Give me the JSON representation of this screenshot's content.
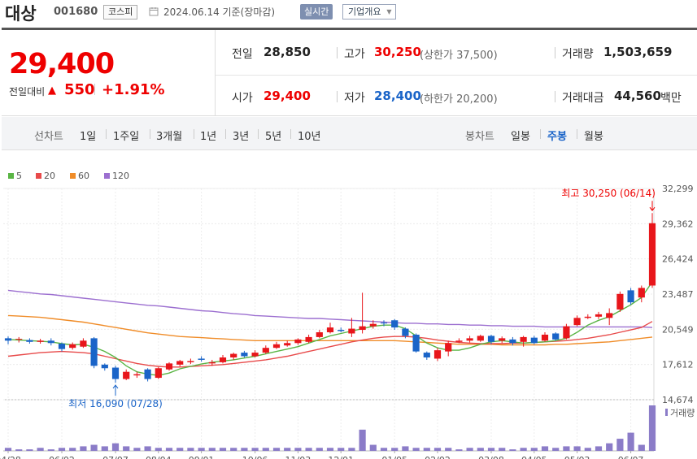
{
  "header": {
    "name": "대상",
    "code": "001680",
    "market": "코스피",
    "date": "2024.06.14 기준(장마감)",
    "realtime_label": "실시간",
    "corp_label": "기업개요"
  },
  "price": {
    "current": "29,400",
    "change_label": "전일대비",
    "change": "550",
    "change_pct": "+1.91%",
    "prev_label": "전일",
    "prev": "28,850",
    "high_label": "고가",
    "high": "30,250",
    "upper_limit": "(상한가 37,500)",
    "volume_label": "거래량",
    "volume": "1,503,659",
    "open_label": "시가",
    "open": "29,400",
    "low_label": "저가",
    "low": "28,400",
    "lower_limit": "(하한가 20,200)",
    "amount_label": "거래대금",
    "amount": "44,560",
    "amount_unit": "백만"
  },
  "period": {
    "line_label": "선차트",
    "line_items": [
      "1일",
      "1주일",
      "3개월",
      "1년",
      "3년",
      "5년",
      "10년"
    ],
    "candle_label": "봉차트",
    "candle_items": [
      "일봉",
      "주봉",
      "월봉"
    ],
    "candle_selected": "주봉"
  },
  "colors": {
    "up": "#e8161b",
    "down": "#1a64c8",
    "ma5": "#5ab545",
    "ma20": "#e84a4a",
    "ma60": "#f08c28",
    "ma120": "#9c6fd0",
    "volume": "#8b7cc8"
  },
  "chart_data": {
    "type": "candlestick",
    "legend": [
      {
        "name": "5",
        "color": "#5ab545"
      },
      {
        "name": "20",
        "color": "#e84a4a"
      },
      {
        "name": "60",
        "color": "#f08c28"
      },
      {
        "name": "120",
        "color": "#9c6fd0"
      }
    ],
    "y_ticks": [
      14674,
      17612,
      20549,
      23487,
      26424,
      29362,
      32299
    ],
    "y_tick_labels": [
      "14,674",
      "17,612",
      "20,549",
      "23,487",
      "26,424",
      "29,362",
      "32,299"
    ],
    "ylim": [
      14674,
      32299
    ],
    "x_tick_labels": [
      "04/28",
      "06/02",
      "07/07",
      "08/04",
      "09/01",
      "10/06",
      "11/03",
      "12/01",
      "01/05",
      "02/02",
      "03/08",
      "04/05",
      "05/03",
      "06/07"
    ],
    "x_tick_index": [
      0,
      5,
      10,
      14,
      18,
      23,
      27,
      31,
      36,
      40,
      45,
      49,
      53,
      58
    ],
    "candles": [
      {
        "o": 19800,
        "c": 19600,
        "h": 19950,
        "l": 19300
      },
      {
        "o": 19700,
        "c": 19750,
        "h": 19900,
        "l": 19450
      },
      {
        "o": 19650,
        "c": 19500,
        "h": 19800,
        "l": 19350
      },
      {
        "o": 19500,
        "c": 19600,
        "h": 19750,
        "l": 19350
      },
      {
        "o": 19600,
        "c": 19400,
        "h": 19800,
        "l": 19200
      },
      {
        "o": 19350,
        "c": 18900,
        "h": 19450,
        "l": 18700
      },
      {
        "o": 19000,
        "c": 19300,
        "h": 19450,
        "l": 18850
      },
      {
        "o": 19100,
        "c": 19600,
        "h": 19800,
        "l": 19000
      },
      {
        "o": 19800,
        "c": 17500,
        "h": 19900,
        "l": 17300
      },
      {
        "o": 17600,
        "c": 17300,
        "h": 17700,
        "l": 17100
      },
      {
        "o": 17350,
        "c": 16400,
        "h": 17500,
        "l": 16090
      },
      {
        "o": 16400,
        "c": 17000,
        "h": 17200,
        "l": 16300
      },
      {
        "o": 16700,
        "c": 16800,
        "h": 17000,
        "l": 16500
      },
      {
        "o": 17200,
        "c": 16400,
        "h": 17300,
        "l": 16200
      },
      {
        "o": 16500,
        "c": 17300,
        "h": 17400,
        "l": 16400
      },
      {
        "o": 17200,
        "c": 17700,
        "h": 17800,
        "l": 17100
      },
      {
        "o": 17600,
        "c": 17900,
        "h": 18000,
        "l": 17450
      },
      {
        "o": 17800,
        "c": 17900,
        "h": 18100,
        "l": 17650
      },
      {
        "o": 18100,
        "c": 18000,
        "h": 18300,
        "l": 17850
      },
      {
        "o": 17700,
        "c": 17800,
        "h": 18000,
        "l": 17500
      },
      {
        "o": 17800,
        "c": 18200,
        "h": 18400,
        "l": 17700
      },
      {
        "o": 18200,
        "c": 18500,
        "h": 18600,
        "l": 18000
      },
      {
        "o": 18600,
        "c": 18300,
        "h": 18750,
        "l": 18200
      },
      {
        "o": 18300,
        "c": 18600,
        "h": 18800,
        "l": 18200
      },
      {
        "o": 18600,
        "c": 19000,
        "h": 19200,
        "l": 18500
      },
      {
        "o": 19000,
        "c": 19300,
        "h": 19500,
        "l": 18900
      },
      {
        "o": 19200,
        "c": 19400,
        "h": 19600,
        "l": 19100
      },
      {
        "o": 19400,
        "c": 19700,
        "h": 19800,
        "l": 19250
      },
      {
        "o": 19500,
        "c": 19900,
        "h": 20100,
        "l": 19400
      },
      {
        "o": 19900,
        "c": 20300,
        "h": 20500,
        "l": 19800
      },
      {
        "o": 20300,
        "c": 20700,
        "h": 21100,
        "l": 20200
      },
      {
        "o": 20500,
        "c": 20400,
        "h": 20700,
        "l": 20300
      },
      {
        "o": 20200,
        "c": 20600,
        "h": 21500,
        "l": 19900
      },
      {
        "o": 20500,
        "c": 20800,
        "h": 23600,
        "l": 20200
      },
      {
        "o": 20800,
        "c": 21000,
        "h": 21300,
        "l": 20600
      },
      {
        "o": 21100,
        "c": 21050,
        "h": 21300,
        "l": 20800
      },
      {
        "o": 21300,
        "c": 20700,
        "h": 21400,
        "l": 20500
      },
      {
        "o": 20600,
        "c": 20000,
        "h": 20700,
        "l": 19800
      },
      {
        "o": 20100,
        "c": 18700,
        "h": 20200,
        "l": 18600
      },
      {
        "o": 18600,
        "c": 18200,
        "h": 18700,
        "l": 18000
      },
      {
        "o": 18100,
        "c": 18800,
        "h": 19000,
        "l": 17900
      },
      {
        "o": 18700,
        "c": 19400,
        "h": 19600,
        "l": 18300
      },
      {
        "o": 19500,
        "c": 19600,
        "h": 19800,
        "l": 19400
      },
      {
        "o": 19600,
        "c": 19800,
        "h": 20000,
        "l": 19450
      },
      {
        "o": 19600,
        "c": 20000,
        "h": 20100,
        "l": 19500
      },
      {
        "o": 20000,
        "c": 19500,
        "h": 20100,
        "l": 19300
      },
      {
        "o": 19600,
        "c": 19800,
        "h": 19950,
        "l": 19400
      },
      {
        "o": 19700,
        "c": 19400,
        "h": 19900,
        "l": 19200
      },
      {
        "o": 19500,
        "c": 19900,
        "h": 20000,
        "l": 19100
      },
      {
        "o": 19850,
        "c": 19400,
        "h": 20000,
        "l": 19300
      },
      {
        "o": 19600,
        "c": 20100,
        "h": 20300,
        "l": 19500
      },
      {
        "o": 20200,
        "c": 19700,
        "h": 20300,
        "l": 19600
      },
      {
        "o": 19800,
        "c": 20800,
        "h": 21000,
        "l": 19700
      },
      {
        "o": 20900,
        "c": 21500,
        "h": 21700,
        "l": 20800
      },
      {
        "o": 21500,
        "c": 21600,
        "h": 21800,
        "l": 21400
      },
      {
        "o": 21600,
        "c": 21800,
        "h": 22000,
        "l": 21400
      },
      {
        "o": 21500,
        "c": 21900,
        "h": 22300,
        "l": 20900
      },
      {
        "o": 22200,
        "c": 23500,
        "h": 23700,
        "l": 22000
      },
      {
        "o": 23800,
        "c": 22800,
        "h": 24000,
        "l": 22600
      },
      {
        "o": 23200,
        "c": 24000,
        "h": 24200,
        "l": 22800
      },
      {
        "o": 24200,
        "c": 29400,
        "h": 30250,
        "l": 24000
      }
    ],
    "ma5": [
      19700,
      19650,
      19600,
      19550,
      19500,
      19350,
      19250,
      19300,
      19050,
      18700,
      18200,
      17500,
      17000,
      16800,
      16700,
      16900,
      17250,
      17450,
      17650,
      17800,
      17900,
      18000,
      18150,
      18300,
      18500,
      18700,
      18900,
      19100,
      19400,
      19700,
      20000,
      20200,
      20400,
      20600,
      20800,
      20900,
      20900,
      20600,
      20000,
      19400,
      19000,
      18800,
      18800,
      19000,
      19300,
      19500,
      19600,
      19500,
      19400,
      19450,
      19500,
      19600,
      19800,
      20300,
      20900,
      21300,
      21600,
      22100,
      22600,
      23200,
      24500
    ],
    "ma20": [
      18300,
      18400,
      18500,
      18600,
      18650,
      18700,
      18650,
      18600,
      18500,
      18300,
      18100,
      17900,
      17700,
      17550,
      17450,
      17400,
      17400,
      17450,
      17500,
      17550,
      17600,
      17700,
      17800,
      17900,
      18000,
      18150,
      18300,
      18500,
      18700,
      18900,
      19100,
      19300,
      19500,
      19650,
      19800,
      19900,
      19950,
      19950,
      19900,
      19800,
      19650,
      19550,
      19450,
      19400,
      19350,
      19350,
      19350,
      19400,
      19400,
      19450,
      19500,
      19550,
      19600,
      19700,
      19800,
      19950,
      20100,
      20300,
      20500,
      20700,
      21200
    ],
    "ma60": [
      21700,
      21650,
      21600,
      21550,
      21450,
      21350,
      21250,
      21150,
      21000,
      20850,
      20700,
      20550,
      20400,
      20250,
      20150,
      20050,
      19950,
      19900,
      19850,
      19800,
      19750,
      19700,
      19650,
      19600,
      19600,
      19600,
      19600,
      19600,
      19600,
      19600,
      19600,
      19600,
      19600,
      19600,
      19600,
      19600,
      19600,
      19550,
      19500,
      19450,
      19400,
      19350,
      19300,
      19300,
      19300,
      19300,
      19250,
      19250,
      19250,
      19250,
      19250,
      19300,
      19300,
      19350,
      19400,
      19450,
      19500,
      19600,
      19700,
      19800,
      19900
    ],
    "ma120": [
      23800,
      23700,
      23600,
      23500,
      23450,
      23350,
      23250,
      23150,
      23050,
      22950,
      22850,
      22750,
      22650,
      22550,
      22500,
      22400,
      22300,
      22200,
      22100,
      22050,
      21950,
      21850,
      21800,
      21700,
      21650,
      21600,
      21550,
      21500,
      21450,
      21450,
      21400,
      21350,
      21300,
      21250,
      21200,
      21150,
      21100,
      21050,
      21050,
      21000,
      21000,
      20950,
      20950,
      20900,
      20900,
      20850,
      20850,
      20800,
      20800,
      20800,
      20750,
      20750,
      20750,
      20750,
      20750,
      20750,
      20750,
      20750,
      20750,
      20750,
      20700
    ],
    "volume_label": "거래량",
    "volume": [
      2,
      1,
      1,
      2,
      1,
      2,
      2,
      3,
      4,
      3,
      5,
      3,
      2,
      3,
      2,
      2,
      2,
      2,
      2,
      2,
      2,
      2,
      2,
      2,
      2,
      2,
      2,
      2,
      2,
      2,
      2,
      2,
      2,
      14,
      4,
      2,
      2,
      3,
      2,
      2,
      2,
      2,
      1,
      2,
      2,
      2,
      2,
      1,
      2,
      2,
      3,
      2,
      3,
      3,
      2,
      3,
      5,
      8,
      12,
      4,
      30
    ],
    "high_annotation": "최고 30,250 (06/14)",
    "low_annotation": "최저 16,090 (07/28)",
    "high_index": 60,
    "low_index": 10,
    "high_value": 30250,
    "low_value": 16090
  }
}
